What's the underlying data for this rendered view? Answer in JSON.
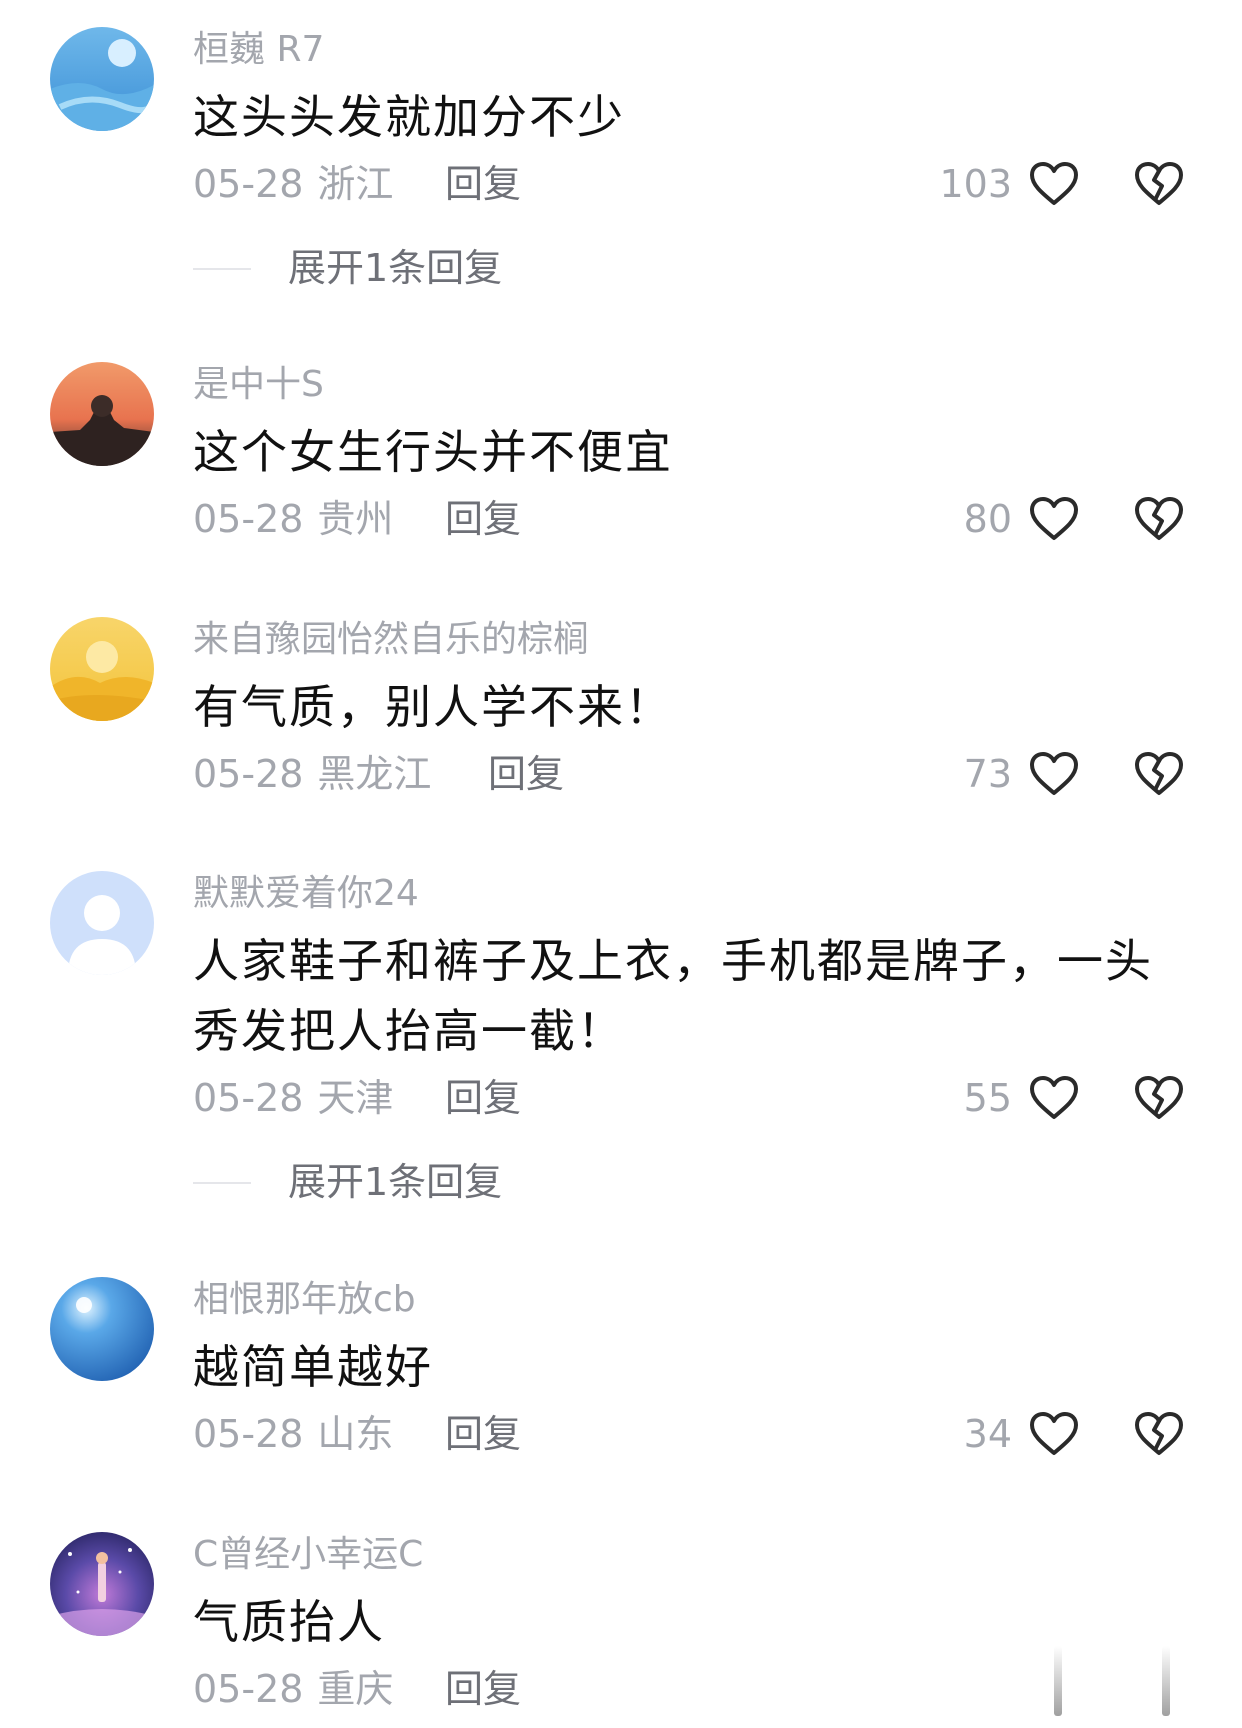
{
  "comments": [
    {
      "username": "桓巍 R7",
      "content": "这头头发就加分不少",
      "date": "05-28",
      "location": "浙江",
      "reply": "回复",
      "likes": "103",
      "expand": "展开1条回复"
    },
    {
      "username": "是中十S",
      "content": "这个女生行头并不便宜",
      "date": "05-28",
      "location": "贵州",
      "reply": "回复",
      "likes": "80"
    },
    {
      "username": "来自豫园怡然自乐的棕榈",
      "content": "有气质，别人学不来！",
      "date": "05-28",
      "location": "黑龙江",
      "reply": "回复",
      "likes": "73"
    },
    {
      "username": "默默爱着你24",
      "content": "人家鞋子和裤子及上衣，手机都是牌子，一头秀发把人抬高一截！",
      "date": "05-28",
      "location": "天津",
      "reply": "回复",
      "likes": "55",
      "expand": "展开1条回复"
    },
    {
      "username": "相恨那年放cb",
      "content": "越简单越好",
      "date": "05-28",
      "location": "山东",
      "reply": "回复",
      "likes": "34"
    },
    {
      "username": "C曾经小幸运C",
      "content": "气质抬人",
      "date": "05-28",
      "location": "重庆",
      "reply": "回复"
    }
  ],
  "icons": {
    "like": "heart-outline-icon",
    "dislike": "broken-heart-icon"
  },
  "colors": {
    "username": "#a3a6ad",
    "content": "#111111",
    "reply": "#6e7077"
  }
}
